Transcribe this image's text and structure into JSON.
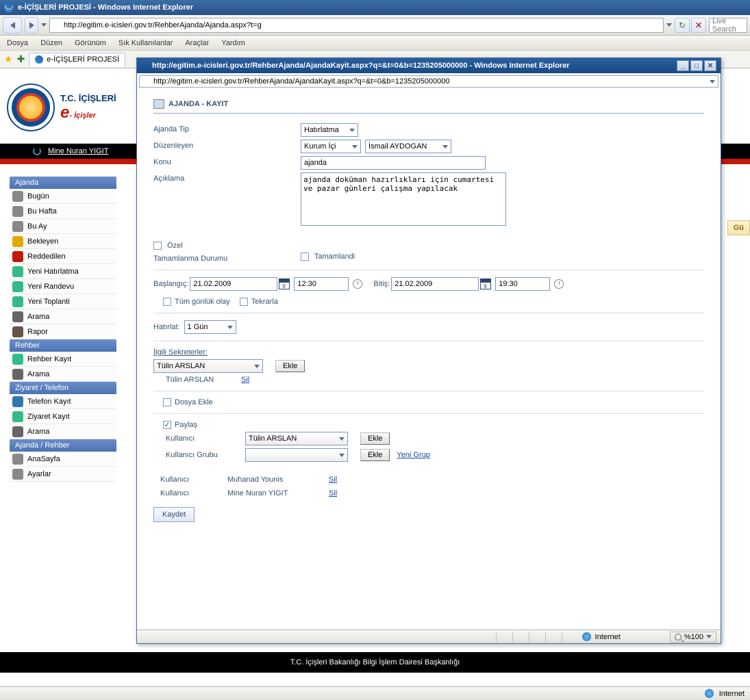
{
  "main_window": {
    "title": "e-İÇİŞLERİ PROJESİ - Windows Internet Explorer",
    "url": "http://egitim.e-icisleri.gov.tr/RehberAjanda/Ajanda.aspx?t=g",
    "search_placeholder": "Live Search",
    "menus": [
      "Dosya",
      "Düzen",
      "Görünüm",
      "Sık Kullanılanlar",
      "Araçlar",
      "Yardım"
    ],
    "tab_label": "e-İÇİŞLERİ PROJESİ",
    "ministry": "T.C. İÇİŞLERİ",
    "brand_e": "e",
    "brand_rest": "- İçişler",
    "username": "Mine Nuran YIGIT",
    "right_badge": "Gü",
    "footer": "T.C. İçişleri Bakanlığı Bilgi İşlem Dairesi Başkanlığı",
    "status_internet": "Internet"
  },
  "sidebar": {
    "sections": [
      {
        "title": "Ajanda",
        "items": [
          {
            "label": "Bugün"
          },
          {
            "label": "Bu Hafta"
          },
          {
            "label": "Bu Ay"
          },
          {
            "label": "Bekleyen"
          },
          {
            "label": "Reddedilen"
          },
          {
            "label": "Yeni Hatırlatma"
          },
          {
            "label": "Yeni Randevu"
          },
          {
            "label": "Yeni Toplanti"
          },
          {
            "label": "Arama"
          },
          {
            "label": "Rapor"
          }
        ]
      },
      {
        "title": "Rehber",
        "items": [
          {
            "label": "Rehber Kayıt"
          },
          {
            "label": "Arama"
          }
        ]
      },
      {
        "title": "Ziyaret / Telefon",
        "items": [
          {
            "label": "Telefon Kayıt"
          },
          {
            "label": "Ziyaret Kayıt"
          },
          {
            "label": "Arama"
          }
        ]
      },
      {
        "title": "Ajanda / Rehber",
        "items": [
          {
            "label": "AnaSayfa"
          },
          {
            "label": "Ayarlar"
          }
        ]
      }
    ]
  },
  "popup": {
    "title": "http://egitim.e-icisleri.gov.tr/RehberAjanda/AjandaKayit.aspx?q=&t=0&b=1235205000000 - Windows Internet Explorer",
    "url": "http://egitim.e-icisleri.gov.tr/RehberAjanda/AjandaKayit.aspx?q=&t=0&b=1235205000000",
    "form_title": "AJANDA - KAYIT",
    "labels": {
      "ajanda_tip": "Ajanda Tip",
      "duzenleyen": "Düzenleyen",
      "konu": "Konu",
      "aciklama": "Açıklama",
      "ozel": "Özel",
      "tamamlanma": "Tamamlanma Durumu",
      "tamamlandi": "Tamamlandi",
      "baslangic": "Başlangıç:",
      "bitis": "Bitiş:",
      "tum_gunluk": "Tüm günlük olay",
      "tekrarla": "Tekrarla",
      "hatirlat": "Hatırlat:",
      "ilgili_sekreter": "İlgili Sekreterler:",
      "dosya_ekle": "Dosya Ekle",
      "paylas": "Paylaş",
      "kullanici": "Kullanıcı",
      "kullanici_grubu": "Kullanıcı Grubu"
    },
    "values": {
      "ajanda_tip": "Hatırlatma",
      "duzenleyen_scope": "Kurum İçi",
      "duzenleyen_kisi": "İsmail AYDOGAN",
      "konu": "ajanda",
      "aciklama": "ajanda doküman hazırlıkları için cumartesi ve pazar günleri çalışma yapılacak",
      "bas_date": "21.02.2009",
      "bas_time": "12:30",
      "bit_date": "21.02.2009",
      "bit_time": "19:30",
      "hatirlat": "1 Gün",
      "sekreter_select": "Tülin ARSLAN",
      "sekreter_added": "Tülin ARSLAN",
      "paylas_checked": true,
      "kullanici_select": "Tülin ARSLAN",
      "kullanici_grubu_select": ""
    },
    "buttons": {
      "ekle": "Ekle",
      "sil": "Sil",
      "yeni_grup": "Yeni Grup",
      "kaydet": "Kaydet"
    },
    "shared_users": [
      {
        "type": "Kullanıcı",
        "name": "Muhanad Younis"
      },
      {
        "type": "Kullanıcı",
        "name": "Mine Nuran YIGIT"
      }
    ],
    "status_internet": "Internet",
    "zoom": "%100"
  }
}
